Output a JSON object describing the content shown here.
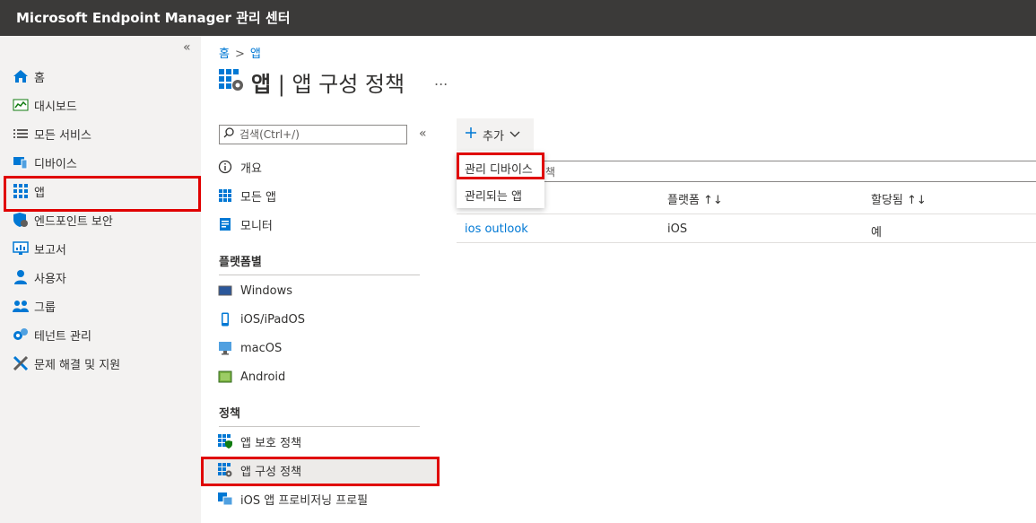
{
  "app_title": "Microsoft Endpoint Manager 관리 센터",
  "nav": {
    "collapse_icon": "«",
    "items": [
      {
        "label": "홈",
        "icon": "home-icon"
      },
      {
        "label": "대시보드",
        "icon": "dashboard-icon"
      },
      {
        "label": "모든 서비스",
        "icon": "list-icon"
      },
      {
        "label": "디바이스",
        "icon": "devices-icon"
      },
      {
        "label": "앱",
        "icon": "apps-icon"
      },
      {
        "label": "엔드포인트 보안",
        "icon": "shield-icon"
      },
      {
        "label": "보고서",
        "icon": "reports-icon"
      },
      {
        "label": "사용자",
        "icon": "user-icon"
      },
      {
        "label": "그룹",
        "icon": "group-icon"
      },
      {
        "label": "테넌트 관리",
        "icon": "tenant-icon"
      },
      {
        "label": "문제 해결 및 지원",
        "icon": "troubleshoot-icon"
      }
    ]
  },
  "breadcrumb": {
    "home": "홈",
    "separator": ">",
    "current": "앱"
  },
  "page": {
    "title_bold": "앱",
    "title_sep": " | ",
    "title_rest": "앱 구성 정책",
    "more": "..."
  },
  "subnav": {
    "search_placeholder": "검색(Ctrl+/)",
    "collapse_icon": "«",
    "top_items": [
      {
        "label": "개요",
        "icon": "info-icon"
      },
      {
        "label": "모든 앱",
        "icon": "apps-icon"
      },
      {
        "label": "모니터",
        "icon": "monitor-icon"
      }
    ],
    "platform_header": "플랫폼별",
    "platform_items": [
      {
        "label": "Windows",
        "icon": "windows-icon"
      },
      {
        "label": "iOS/iPadOS",
        "icon": "phone-icon"
      },
      {
        "label": "macOS",
        "icon": "mac-icon"
      },
      {
        "label": "Android",
        "icon": "android-icon"
      }
    ],
    "policy_header": "정책",
    "policy_items": [
      {
        "label": "앱 보호 정책",
        "icon": "app-protection-icon"
      },
      {
        "label": "앱 구성 정책",
        "icon": "app-config-icon"
      },
      {
        "label": "iOS 앱 프로비저닝 프로필",
        "icon": "provisioning-icon"
      }
    ]
  },
  "toolbar": {
    "add_label": "추가"
  },
  "dropdown": {
    "items": [
      "관리 디바이스",
      "관리되는 앱"
    ]
  },
  "filter": {
    "partial": "책"
  },
  "table": {
    "columns": [
      "플랫폼 ↑↓",
      "할당됨 ↑↓"
    ],
    "rows": [
      {
        "name": "ios outlook",
        "platform": "iOS",
        "assigned": "예"
      }
    ]
  },
  "colors": {
    "accent": "#0078d4",
    "highlight": "#e00000",
    "topbar": "#3b3a39"
  }
}
